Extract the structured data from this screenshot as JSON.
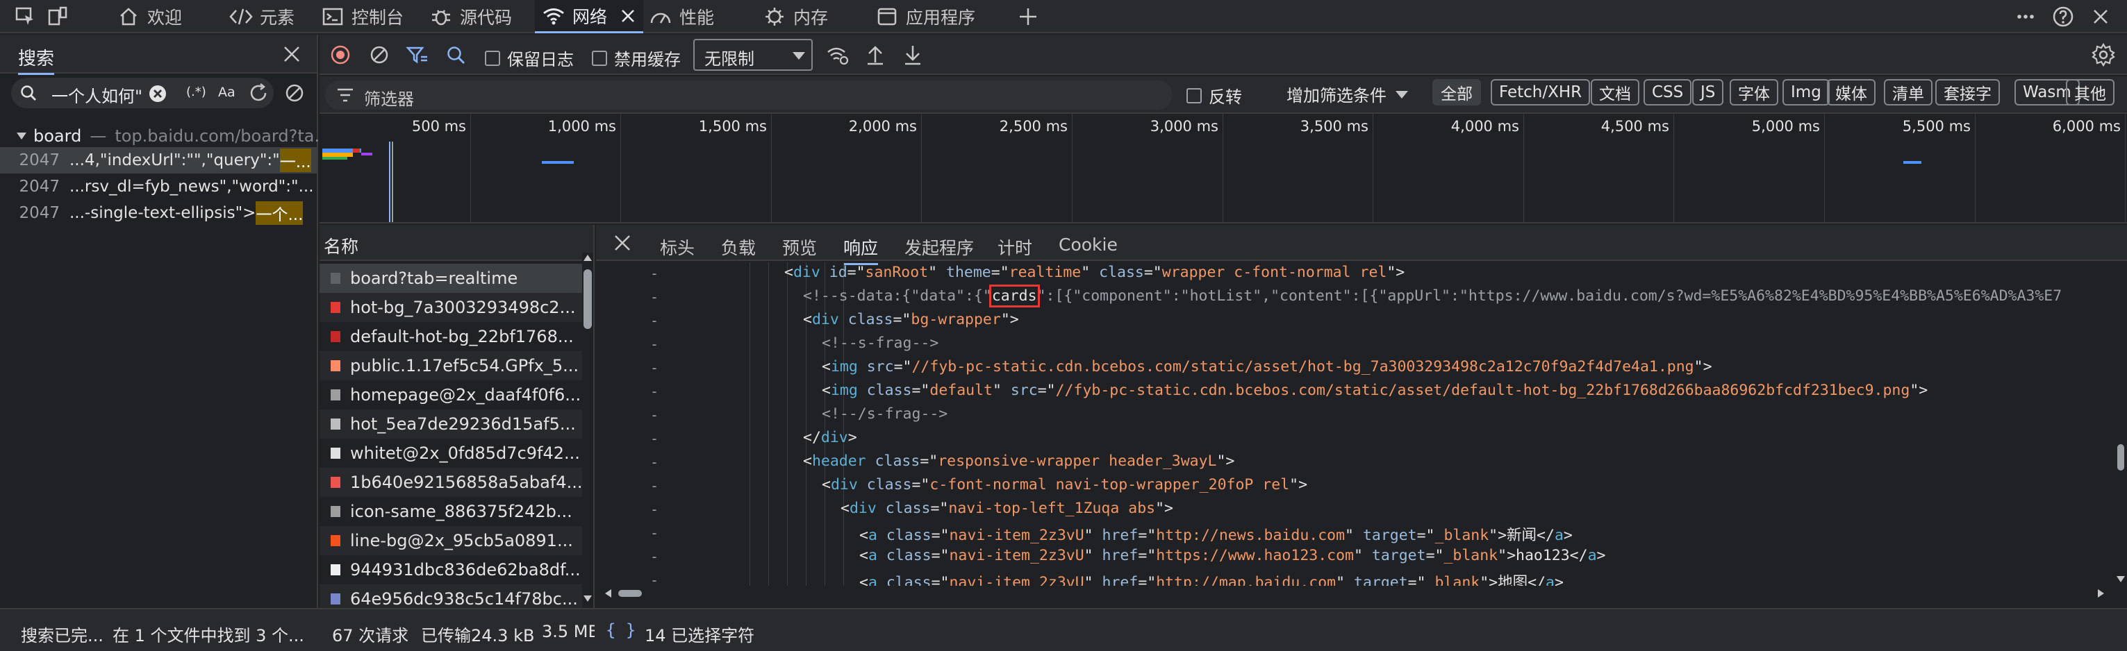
{
  "top_tabs": [
    {
      "label": "欢迎",
      "icon": "home-icon"
    },
    {
      "label": "元素",
      "icon": "code-icon"
    },
    {
      "label": "控制台",
      "icon": "console-icon"
    },
    {
      "label": "源代码",
      "icon": "bug-icon"
    },
    {
      "label": "网络",
      "icon": "wifi-icon"
    },
    {
      "label": "性能",
      "icon": "performance-icon"
    },
    {
      "label": "内存",
      "icon": "memory-icon"
    },
    {
      "label": "应用程序",
      "icon": "app-window-icon"
    }
  ],
  "network_toolbar": {
    "preserve_log": "保留日志",
    "disable_cache": "禁用缓存",
    "throttle": "无限制"
  },
  "search_panel": {
    "title": "搜索",
    "query": "一个人如何\"",
    "case_label": "Aa",
    "regex_label": "(.*)",
    "tree_root": "board",
    "tree_url": "top.baidu.com/board?ta...",
    "results": [
      {
        "line": "2047",
        "pre": "...4,\"indexUrl\":\"\",\"query\":\"",
        "hit": "一..."
      },
      {
        "line": "2047",
        "pre": "...rsv_dl=fyb_news\",\"word\":\"...",
        "hit": ""
      },
      {
        "line": "2047",
        "pre": "...-single-text-ellipsis\"> ",
        "hit": "一个..."
      }
    ],
    "status": "搜索已完...",
    "found": "在 1 个文件中找到 3 个..."
  },
  "filter_bar": {
    "placeholder": "筛选器",
    "invert": "反转",
    "more_filters": "增加筛选条件",
    "chips": [
      "全部",
      "Fetch/XHR",
      "文档",
      "CSS",
      "JS",
      "字体",
      "Img",
      "媒体",
      "清单",
      "套接字",
      "Wasm",
      "其他"
    ]
  },
  "timeline": {
    "labels": [
      "500 ms",
      "1,000 ms",
      "1,500 ms",
      "2,000 ms",
      "2,500 ms",
      "3,000 ms",
      "3,500 ms",
      "4,000 ms",
      "4,500 ms",
      "5,000 ms",
      "5,500 ms",
      "6,000 ms"
    ]
  },
  "request_list": {
    "header": "名称",
    "items": [
      {
        "name": "board?tab=realtime",
        "color": "#5f6368"
      },
      {
        "name": "hot-bg_7a3003293498c2...",
        "color": "#e53935"
      },
      {
        "name": "default-hot-bg_22bf1768...",
        "color": "#c62828"
      },
      {
        "name": "public.1.17ef5c54.GPfx_5...",
        "color": "#ff8a65"
      },
      {
        "name": "homepage@2x_daaf4f0f6...",
        "color": "#9e9e9e"
      },
      {
        "name": "hot_5ea7de29236d15af5...",
        "color": "#bdbdbd"
      },
      {
        "name": "whitet@2x_0fd85d7c9f42...",
        "color": "#e0e0e0"
      },
      {
        "name": "1b640e92156858a5abaf4...",
        "color": "#ef5350"
      },
      {
        "name": "icon-same_886375f242b...",
        "color": "#9e9e9e"
      },
      {
        "name": "line-bg@2x_95cb5a0891...",
        "color": "#f4511e"
      },
      {
        "name": "944931dbc836de62ba8df...",
        "color": "#eeeeee"
      },
      {
        "name": "64e956dc938c5c14f78bc...",
        "color": "#7986cb"
      }
    ]
  },
  "detail_tabs": [
    "标头",
    "负载",
    "预览",
    "响应",
    "发起程序",
    "计时",
    "Cookie"
  ],
  "response_lines": [
    {
      "indent": 5,
      "parts": [
        [
          "p",
          "<"
        ],
        [
          "t",
          "div"
        ],
        [
          "p",
          " "
        ],
        [
          "a",
          "id"
        ],
        [
          "p",
          "=\""
        ],
        [
          "v",
          "sanRoot"
        ],
        [
          "p",
          "\" "
        ],
        [
          "a",
          "theme"
        ],
        [
          "p",
          "=\""
        ],
        [
          "v",
          "realtime"
        ],
        [
          "p",
          "\" "
        ],
        [
          "a",
          "class"
        ],
        [
          "p",
          "=\""
        ],
        [
          "v",
          "wrapper c-font-normal rel"
        ],
        [
          "p",
          "\">"
        ]
      ]
    },
    {
      "indent": 6,
      "parts": [
        [
          "c",
          "<!--s-data:{\"data\":{\""
        ],
        [
          "h",
          "cards"
        ],
        [
          "c",
          "\":[{\"component\":\"hotList\",\"content\":[{\"appUrl\":\"https://www.baidu.com/s?wd=%E5%A6%82%E4%BD%95%E4%BB%A5%E6%AD%A3%E7"
        ]
      ]
    },
    {
      "indent": 6,
      "parts": [
        [
          "p",
          "<"
        ],
        [
          "t",
          "div"
        ],
        [
          "p",
          " "
        ],
        [
          "a",
          "class"
        ],
        [
          "p",
          "=\""
        ],
        [
          "v",
          "bg-wrapper"
        ],
        [
          "p",
          "\">"
        ]
      ]
    },
    {
      "indent": 7,
      "parts": [
        [
          "c",
          "<!--s-frag-->"
        ]
      ]
    },
    {
      "indent": 7,
      "parts": [
        [
          "p",
          "<"
        ],
        [
          "t",
          "img"
        ],
        [
          "p",
          " "
        ],
        [
          "a",
          "src"
        ],
        [
          "p",
          "=\""
        ],
        [
          "v",
          "//fyb-pc-static.cdn.bcebos.com/static/asset/hot-bg_7a3003293498c2a12c70f9a2f4d7e4a1.png"
        ],
        [
          "p",
          "\">"
        ]
      ]
    },
    {
      "indent": 7,
      "parts": [
        [
          "p",
          "<"
        ],
        [
          "t",
          "img"
        ],
        [
          "p",
          " "
        ],
        [
          "a",
          "class"
        ],
        [
          "p",
          "=\""
        ],
        [
          "v",
          "default"
        ],
        [
          "p",
          "\" "
        ],
        [
          "a",
          "src"
        ],
        [
          "p",
          "=\""
        ],
        [
          "v",
          "//fyb-pc-static.cdn.bcebos.com/static/asset/default-hot-bg_22bf1768d266baa86962bfcdf231bec9.png"
        ],
        [
          "p",
          "\">"
        ]
      ]
    },
    {
      "indent": 7,
      "parts": [
        [
          "c",
          "<!--/s-frag-->"
        ]
      ]
    },
    {
      "indent": 6,
      "parts": [
        [
          "p",
          "</"
        ],
        [
          "t",
          "div"
        ],
        [
          "p",
          ">"
        ]
      ]
    },
    {
      "indent": 6,
      "parts": [
        [
          "p",
          "<"
        ],
        [
          "t",
          "header"
        ],
        [
          "p",
          " "
        ],
        [
          "a",
          "class"
        ],
        [
          "p",
          "=\""
        ],
        [
          "v",
          "responsive-wrapper header_3wayL"
        ],
        [
          "p",
          "\">"
        ]
      ]
    },
    {
      "indent": 7,
      "parts": [
        [
          "p",
          "<"
        ],
        [
          "t",
          "div"
        ],
        [
          "p",
          " "
        ],
        [
          "a",
          "class"
        ],
        [
          "p",
          "=\""
        ],
        [
          "v",
          "c-font-normal navi-top-wrapper_20foP rel"
        ],
        [
          "p",
          "\">"
        ]
      ]
    },
    {
      "indent": 8,
      "parts": [
        [
          "p",
          "<"
        ],
        [
          "t",
          "div"
        ],
        [
          "p",
          " "
        ],
        [
          "a",
          "class"
        ],
        [
          "p",
          "=\""
        ],
        [
          "v",
          "navi-top-left_1Zuqa abs"
        ],
        [
          "p",
          "\">"
        ]
      ]
    },
    {
      "indent": 9,
      "parts": [
        [
          "p",
          "<"
        ],
        [
          "t",
          "a"
        ],
        [
          "p",
          " "
        ],
        [
          "a",
          "class"
        ],
        [
          "p",
          "=\""
        ],
        [
          "v",
          "navi-item_2z3vU"
        ],
        [
          "p",
          "\" "
        ],
        [
          "a",
          "href"
        ],
        [
          "p",
          "=\""
        ],
        [
          "v",
          "http://news.baidu.com"
        ],
        [
          "p",
          "\" "
        ],
        [
          "a",
          "target"
        ],
        [
          "p",
          "=\""
        ],
        [
          "v",
          "_blank"
        ],
        [
          "p",
          "\">新闻</"
        ],
        [
          "t",
          "a"
        ],
        [
          "p",
          ">"
        ]
      ]
    },
    {
      "indent": 9,
      "parts": [
        [
          "p",
          "<"
        ],
        [
          "t",
          "a"
        ],
        [
          "p",
          " "
        ],
        [
          "a",
          "class"
        ],
        [
          "p",
          "=\""
        ],
        [
          "v",
          "navi-item_2z3vU"
        ],
        [
          "p",
          "\" "
        ],
        [
          "a",
          "href"
        ],
        [
          "p",
          "=\""
        ],
        [
          "v",
          "https://www.hao123.com"
        ],
        [
          "p",
          "\" "
        ],
        [
          "a",
          "target"
        ],
        [
          "p",
          "=\""
        ],
        [
          "v",
          "_blank"
        ],
        [
          "p",
          "\">hao123</"
        ],
        [
          "t",
          "a"
        ],
        [
          "p",
          ">"
        ]
      ]
    },
    {
      "indent": 9,
      "parts": [
        [
          "p",
          "<"
        ],
        [
          "t",
          "a"
        ],
        [
          "p",
          " "
        ],
        [
          "a",
          "class"
        ],
        [
          "p",
          "=\""
        ],
        [
          "v",
          "navi-item_2z3vU"
        ],
        [
          "p",
          "\" "
        ],
        [
          "a",
          "href"
        ],
        [
          "p",
          "=\""
        ],
        [
          "v",
          "http://map.baidu.com"
        ],
        [
          "p",
          "\" "
        ],
        [
          "a",
          "target"
        ],
        [
          "p",
          "=\""
        ],
        [
          "v",
          "_blank"
        ],
        [
          "p",
          "\">地图</"
        ],
        [
          "t",
          "a"
        ],
        [
          "p",
          ">"
        ]
      ]
    }
  ],
  "status_bar": {
    "requests": "67 次请求",
    "transferred": "已传输24.3 kB",
    "size": "3.5 MB",
    "braces": "{ }",
    "selected": "14 已选择字符"
  },
  "colors": {
    "accent": "#8ab4f8",
    "record": "#f28b82",
    "highlight_box": "#e53935"
  }
}
